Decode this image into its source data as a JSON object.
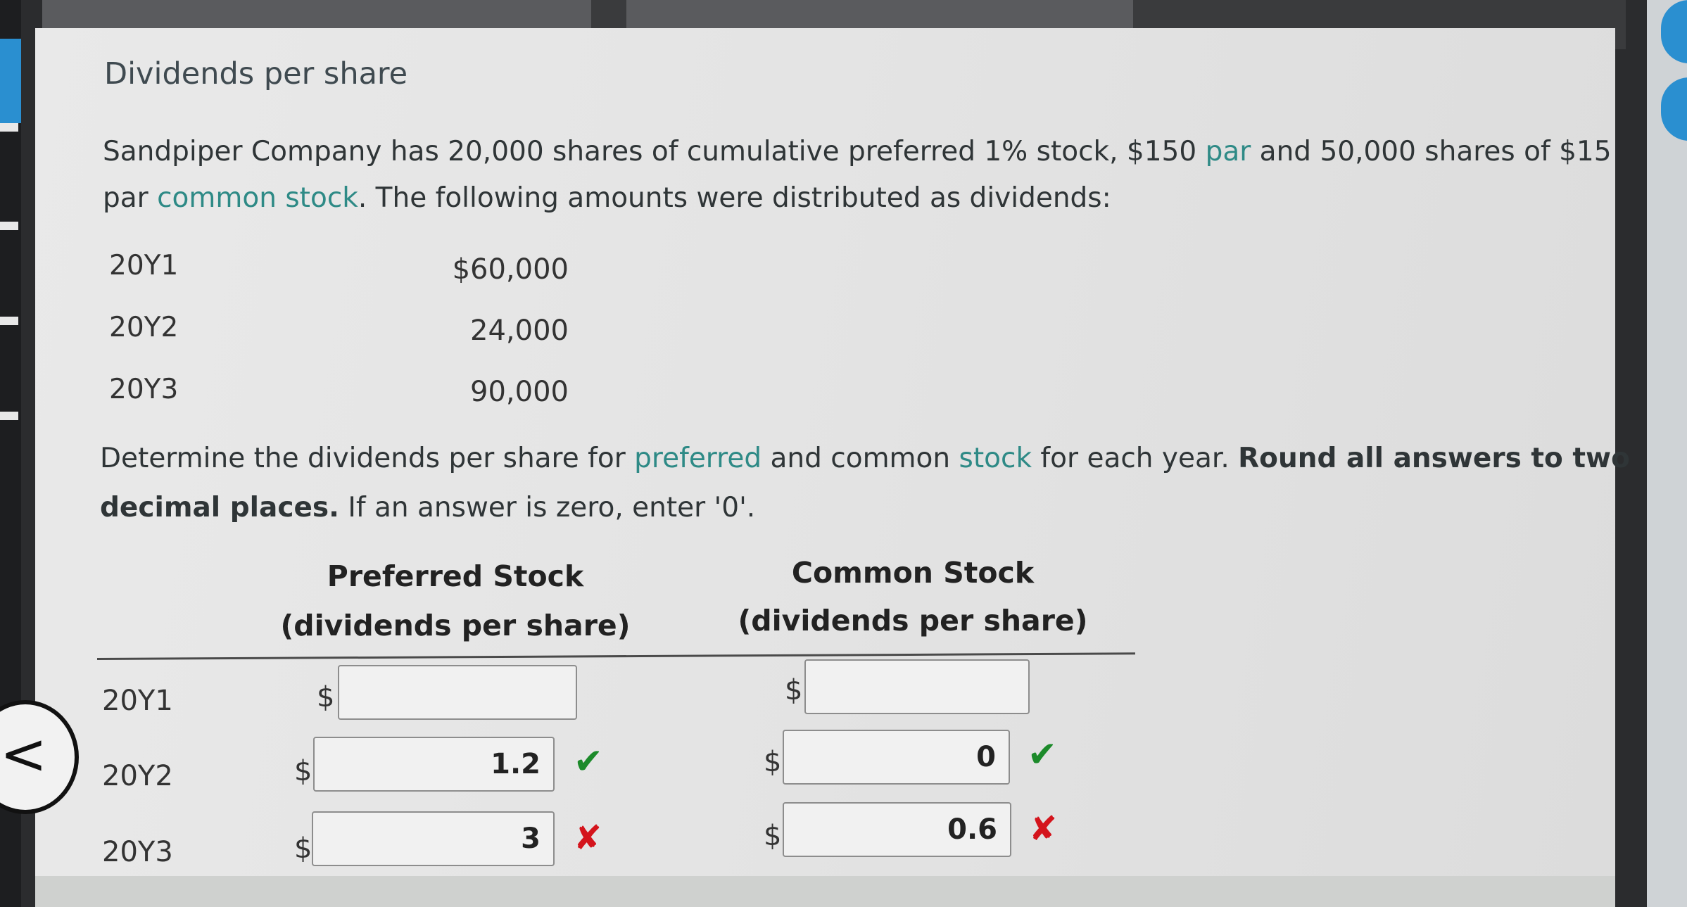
{
  "heading": "Dividends per share",
  "problem": {
    "line1_a": "Sandpiper Company has 20,000 shares of cumulative preferred 1% stock, $150 ",
    "line1_link": "par",
    "line1_b": " and 50,000 shares of $15",
    "line2_a": "par ",
    "line2_link": "common stock",
    "line2_b": ". The following amounts were distributed as dividends:"
  },
  "given": [
    {
      "year": "20Y1",
      "amount": "$60,000"
    },
    {
      "year": "20Y2",
      "amount": "24,000"
    },
    {
      "year": "20Y3",
      "amount": "90,000"
    }
  ],
  "instruction": {
    "line1_a": "Determine the dividends per share for ",
    "line1_link1": "preferred",
    "line1_b": " and common ",
    "line1_link2": "stock",
    "line1_c": " for each year. ",
    "line1_bold": "Round all answers to two",
    "line2_bold": "decimal places.",
    "line2_rest": " If an answer is zero, enter '0'."
  },
  "table": {
    "preferred_head1": "Preferred Stock",
    "preferred_head2": "(dividends per share)",
    "common_head1": "Common Stock",
    "common_head2": "(dividends per share)",
    "currency": "$",
    "rows": [
      {
        "year": "20Y1",
        "preferred": "",
        "common": "",
        "preferred_status": "",
        "common_status": ""
      },
      {
        "year": "20Y2",
        "preferred": "1.2",
        "common": "0",
        "preferred_status": "✔",
        "common_status": "✔"
      },
      {
        "year": "20Y3",
        "preferred": "3",
        "common": "0.6",
        "preferred_status": "✘",
        "common_status": "✘"
      }
    ]
  },
  "nav": {
    "back_glyph": "<"
  },
  "colors": {
    "link": "#2e8a86",
    "correct": "#1c8a2a",
    "incorrect": "#d4141c",
    "accent": "#2a8fd0"
  }
}
